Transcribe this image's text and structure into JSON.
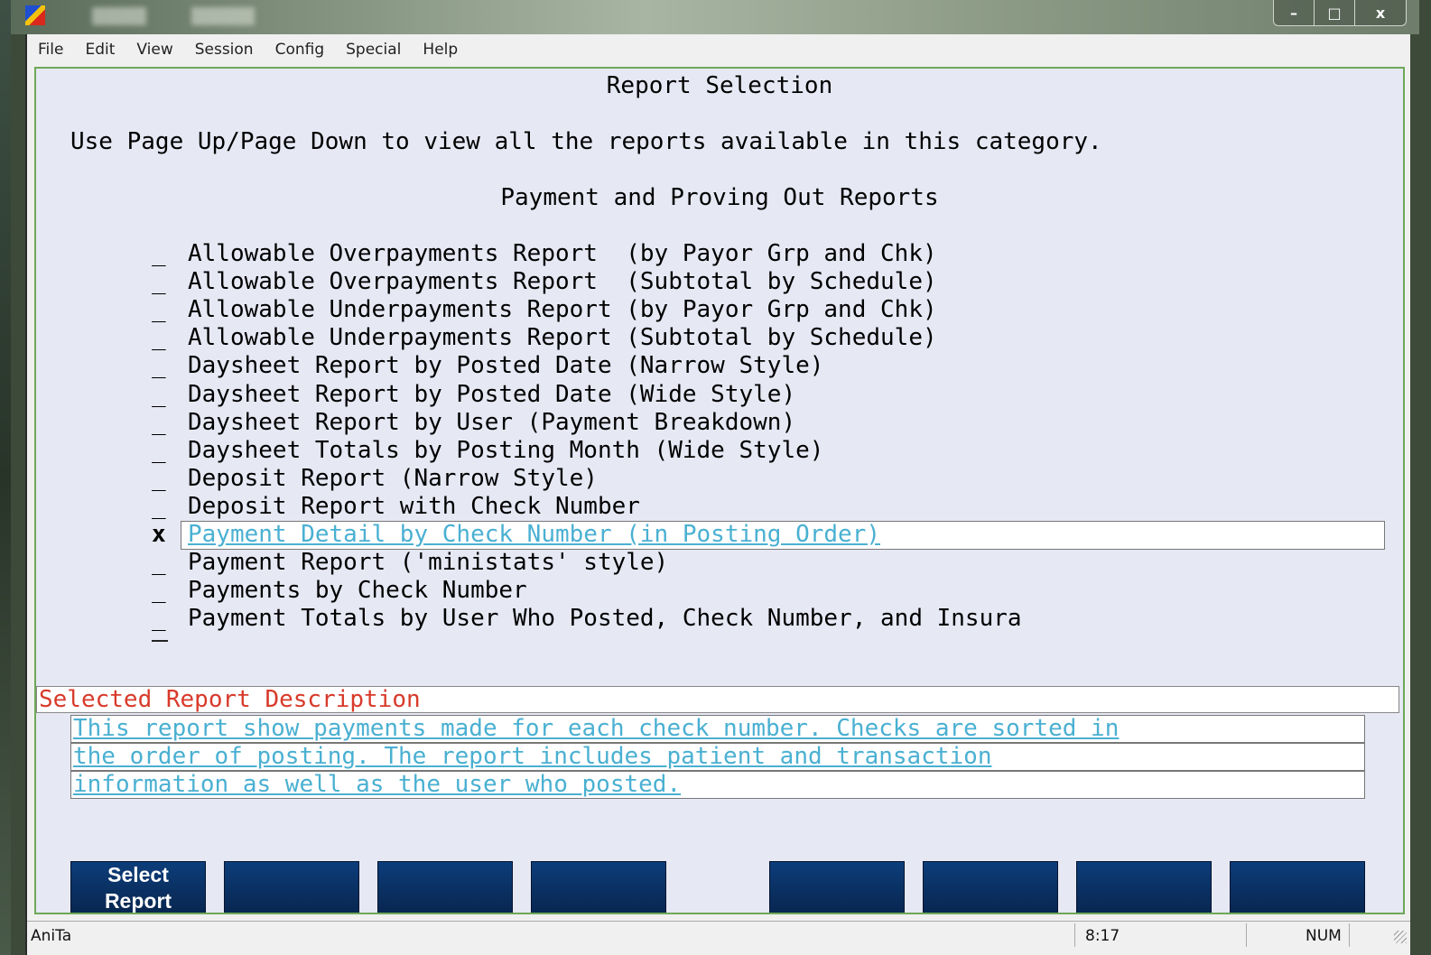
{
  "window": {
    "controls": [
      "–",
      "□",
      "x"
    ]
  },
  "menu": [
    "File",
    "Edit",
    "View",
    "Session",
    "Config",
    "Special",
    "Help"
  ],
  "screen": {
    "title": "Report Selection",
    "instruction": "Use Page Up/Page Down to view all the reports available in this category.",
    "category": "Payment and Proving Out Reports"
  },
  "reports": [
    {
      "mark": "_",
      "label": "Allowable Overpayments Report  (by Payor Grp and Chk)"
    },
    {
      "mark": "_",
      "label": "Allowable Overpayments Report  (Subtotal by Schedule)"
    },
    {
      "mark": "_",
      "label": "Allowable Underpayments Report (by Payor Grp and Chk)"
    },
    {
      "mark": "_",
      "label": "Allowable Underpayments Report (Subtotal by Schedule)"
    },
    {
      "mark": "_",
      "label": "Daysheet Report by Posted Date (Narrow Style)"
    },
    {
      "mark": "_",
      "label": "Daysheet Report by Posted Date (Wide Style)"
    },
    {
      "mark": "_",
      "label": "Daysheet Report by User (Payment Breakdown)"
    },
    {
      "mark": "_",
      "label": "Daysheet Totals by Posting Month (Wide Style)"
    },
    {
      "mark": "_",
      "label": "Deposit Report (Narrow Style)"
    },
    {
      "mark": "_",
      "label": "Deposit Report with Check Number"
    },
    {
      "mark": "x",
      "label": "Payment Detail by Check Number (in Posting Order)",
      "selected": true
    },
    {
      "mark": "_",
      "label": "Payment Report ('ministats' style)"
    },
    {
      "mark": "_",
      "label": "Payments by Check Number"
    },
    {
      "mark": "_",
      "label": "Payment Totals by User Who Posted, Check Number, and Insura"
    }
  ],
  "description": {
    "header": "Selected Report Description",
    "lines": [
      "This report show payments made for each check number. Checks are sorted in",
      "the order of posting. The report includes patient and transaction",
      "information as well as the user who posted."
    ]
  },
  "function_keys": [
    {
      "label": "Select\nReport"
    },
    {
      "label": ""
    },
    {
      "label": ""
    },
    {
      "label": ""
    },
    {
      "label": ""
    },
    {
      "label": ""
    },
    {
      "label": ""
    },
    {
      "label": ""
    }
  ],
  "status": {
    "user": "AniTa",
    "time": "8:17",
    "num": "NUM"
  },
  "colors": {
    "terminal_bg": "#e6e8f4",
    "selected_text": "#4ab0d2",
    "desc_header": "#d83a2a",
    "fkey_bg": "#0a2f60"
  }
}
